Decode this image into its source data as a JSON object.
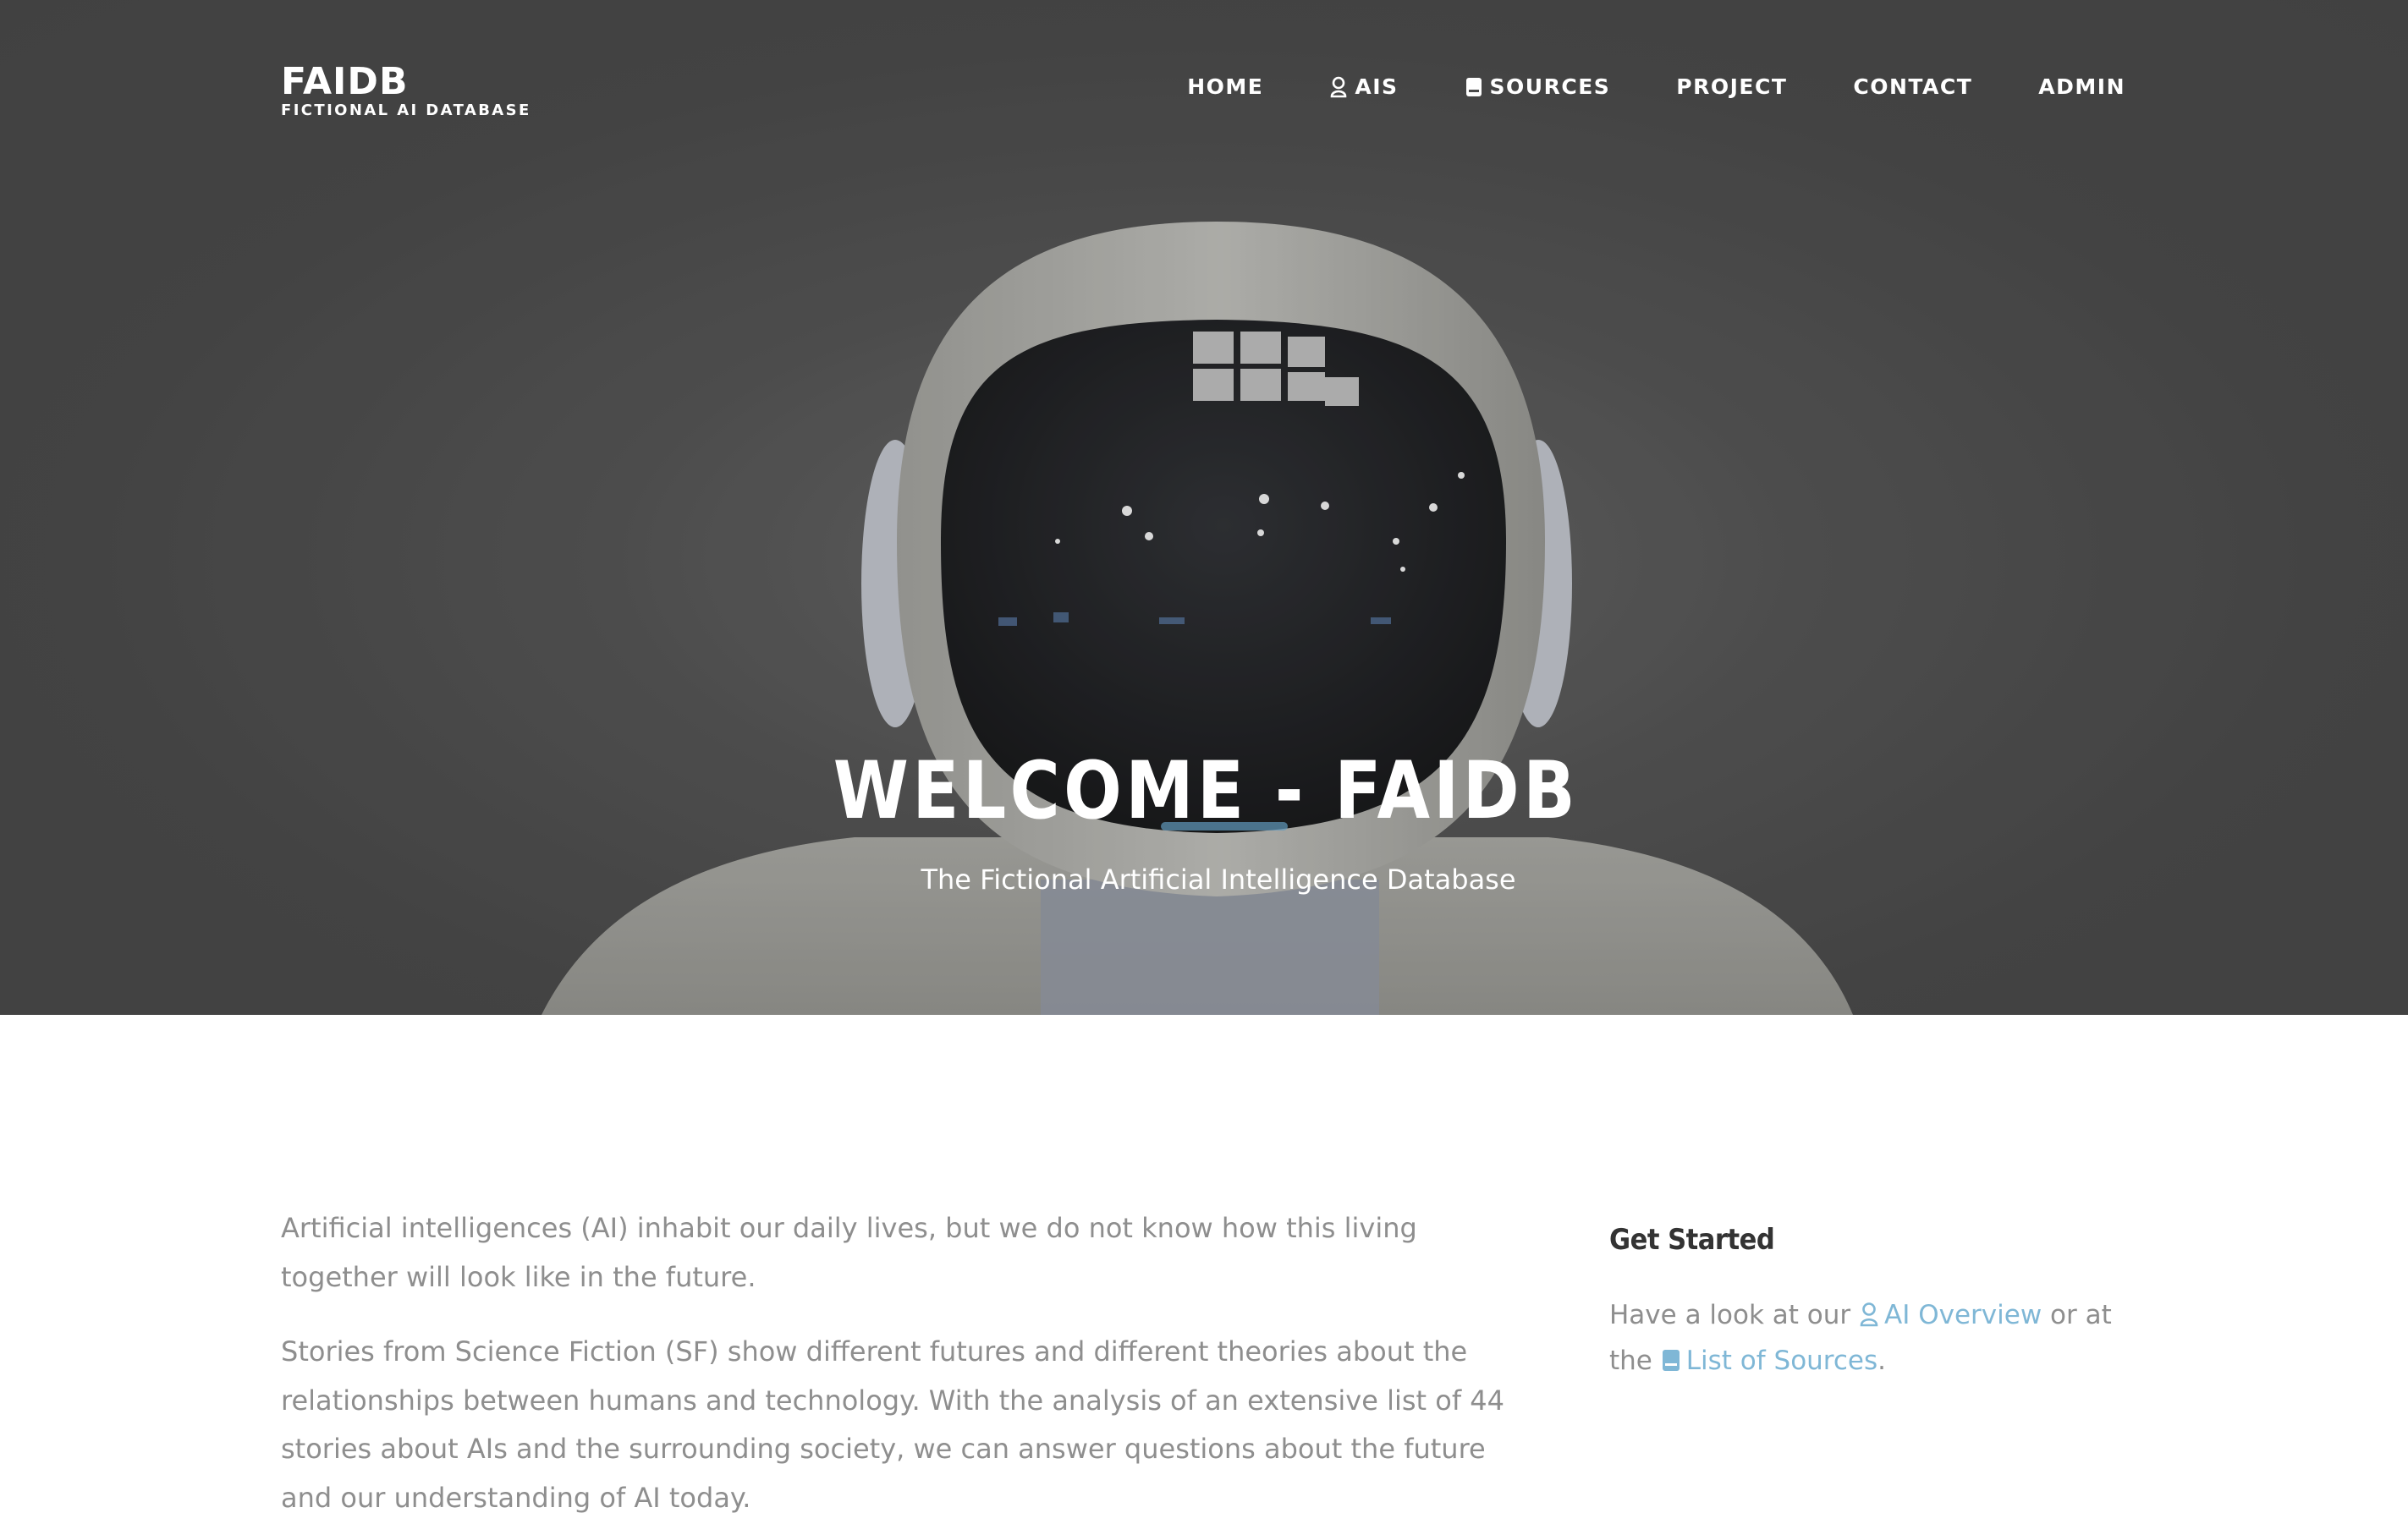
{
  "brand": {
    "title": "FAIDB",
    "subtitle": "FICTIONAL AI DATABASE"
  },
  "nav": {
    "items": [
      {
        "label": "HOME",
        "icon": null
      },
      {
        "label": "AIS",
        "icon": "user-icon"
      },
      {
        "label": "SOURCES",
        "icon": "book-icon"
      },
      {
        "label": "PROJECT",
        "icon": null
      },
      {
        "label": "CONTACT",
        "icon": null
      },
      {
        "label": "ADMIN",
        "icon": null
      }
    ]
  },
  "hero": {
    "title": "WELCOME - FAIDB",
    "subtitle": "The Fictional Artificial Intelligence Database"
  },
  "main": {
    "paragraphs": [
      "Artificial intelligences (AI) inhabit our daily lives, but we do not know how this living together will look like in the future.",
      "Stories from Science Fiction (SF) show different futures and different theories about the relationships between humans and technology. With the analysis of an extensive list of 44 stories about AIs and the surrounding society, we can answer questions about the future and our understanding of AI today."
    ]
  },
  "sidebar": {
    "title": "Get Started",
    "text_before": "Have a look at our",
    "link_ai_overview": "AI Overview",
    "text_middle": "or at the",
    "link_sources": "List of Sources",
    "text_end": "."
  },
  "colors": {
    "link": "#7fb7d6",
    "body_text": "#8e8e8e",
    "heading": "#333333",
    "hero_bg": "#4a4a4a"
  }
}
